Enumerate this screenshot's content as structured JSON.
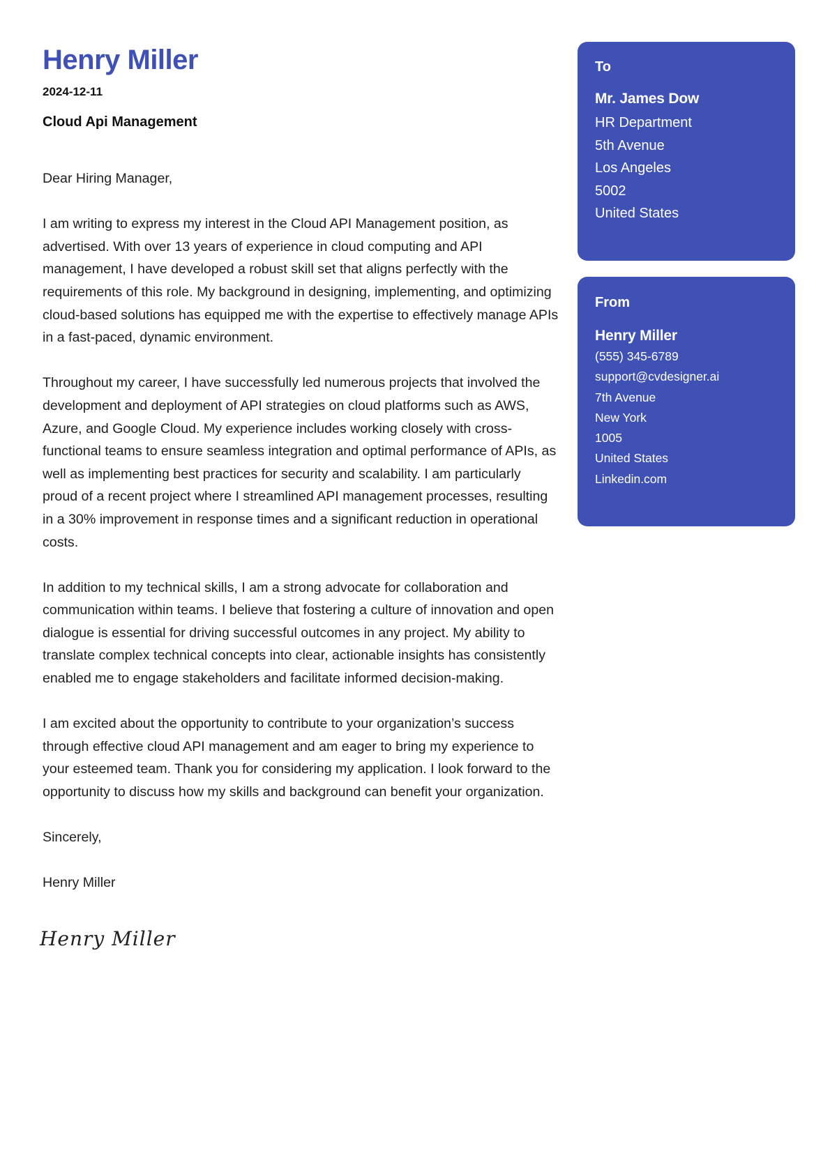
{
  "header": {
    "name": "Henry Miller",
    "date": "2024-12-11",
    "subject": "Cloud Api Management"
  },
  "letter": {
    "greeting": "Dear Hiring Manager,",
    "paragraphs": [
      "I am writing to express my interest in the Cloud API Management position, as advertised. With over 13 years of experience in cloud computing and API management, I have developed a robust skill set that aligns perfectly with the requirements of this role. My background in designing, implementing, and optimizing cloud-based solutions has equipped me with the expertise to effectively manage APIs in a fast-paced, dynamic environment.",
      "Throughout my career, I have successfully led numerous projects that involved the development and deployment of API strategies on cloud platforms such as AWS, Azure, and Google Cloud. My experience includes working closely with cross-functional teams to ensure seamless integration and optimal performance of APIs, as well as implementing best practices for security and scalability. I am particularly proud of a recent project where I streamlined API management processes, resulting in a 30% improvement in response times and a significant reduction in operational costs.",
      "In addition to my technical skills, I am a strong advocate for collaboration and communication within teams. I believe that fostering a culture of innovation and open dialogue is essential for driving successful outcomes in any project. My ability to translate complex technical concepts into clear, actionable insights has consistently enabled me to engage stakeholders and facilitate informed decision-making.",
      "I am excited about the opportunity to contribute to your organization’s success through effective cloud API management and am eager to bring my experience to your esteemed team. Thank you for considering my application. I look forward to the opportunity to discuss how my skills and background can benefit your organization."
    ],
    "closing": "Sincerely,",
    "closing_name": "Henry Miller",
    "signature": "Henry Miller"
  },
  "to": {
    "label": "To",
    "name": "Mr. James Dow",
    "lines": [
      "HR Department",
      "5th Avenue",
      "Los Angeles",
      "5002",
      "United States"
    ]
  },
  "from": {
    "label": "From",
    "name": "Henry Miller",
    "lines": [
      "(555) 345-6789",
      "support@cvdesigner.ai",
      "7th Avenue",
      "New York",
      "1005",
      "United States",
      "Linkedin.com"
    ]
  },
  "colors": {
    "accent": "#3F51B5",
    "card_text": "#FFFFFF"
  }
}
